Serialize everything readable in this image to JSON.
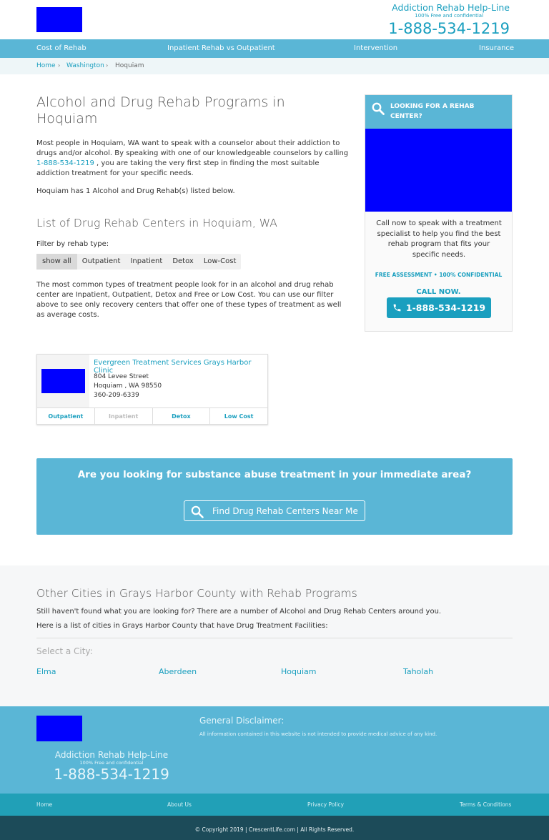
{
  "header": {
    "helpline_title": "Addiction Rehab Help-Line",
    "helpline_sub": "100% Free and confidential",
    "phone": "1-888-534-1219"
  },
  "nav": [
    "Cost of Rehab",
    "Inpatient Rehab vs Outpatient",
    "Intervention",
    "Insurance"
  ],
  "breadcrumb": [
    "Home",
    "Washington",
    "Hoquiam"
  ],
  "main": {
    "title": "Alcohol and Drug Rehab Programs in Hoquiam",
    "intro_pre": "Most people in Hoquiam, WA want to speak with a counselor about their addiction to drugs and/or alcohol. By speaking with one of our knowledgeable counselors by calling ",
    "intro_phone": "1-888-534-1219",
    "intro_post": " , you are taking the very first step in finding the most suitable addiction treatment for your specific needs.",
    "count_text": "Hoquiam has 1 Alcohol and Drug Rehab(s) listed below.",
    "list_title": "List of Drug Rehab Centers in Hoquiam, WA",
    "filter_label": "Filter by rehab type:",
    "filters": [
      "show all",
      "Outpatient",
      "Inpatient",
      "Detox",
      "Low-Cost"
    ],
    "filter_note": "The most common types of treatment people look for in an alcohol and drug rehab center are Inpatient, Outpatient, Detox and Free or Low Cost. You can use our filter above to see only recovery centers that offer one of these types of treatment as well as average costs."
  },
  "sidebar": {
    "heading_line1": "LOOKING FOR A REHAB",
    "heading_line2": "CENTER?",
    "call_text": "Call now to speak with a treatment specialist to help you find the best rehab program that fits your specific needs.",
    "free_text": "FREE ASSESSMENT • 100% CONFIDENTIAL",
    "call_now": "CALL NOW.",
    "phone": "1-888-534-1219"
  },
  "listing": {
    "name": "Evergreen Treatment Services Grays Harbor Clinic",
    "street": "804 Levee Street",
    "city": "Hoquiam , WA 98550",
    "phone": "360-209-6339",
    "tags": [
      {
        "label": "Outpatient",
        "active": true
      },
      {
        "label": "Inpatient",
        "active": false
      },
      {
        "label": "Detox",
        "active": true
      },
      {
        "label": "Low Cost",
        "active": true
      }
    ]
  },
  "cta": {
    "question": "Are you looking for substance abuse treatment in your immediate area?",
    "button": "Find Drug Rehab Centers Near Me"
  },
  "cities": {
    "title": "Other Cities in Grays Harbor County with Rehab Programs",
    "line1": "Still haven't found what you are looking for? There are a number of Alcohol and Drug Rehab Centers around you.",
    "line2": "Here is a list of cities in Grays Harbor County that have Drug Treatment Facilities:",
    "select_label": "Select a City:",
    "list": [
      "Elma",
      "Aberdeen",
      "Hoquiam",
      "Taholah"
    ]
  },
  "footer": {
    "helpline_title": "Addiction Rehab Help-Line",
    "helpline_sub": "100% Free and confidential",
    "phone": "1-888-534-1219",
    "disclaimer_title": "General Disclaimer:",
    "disclaimer_text": "All information contained in this website is not intended to provide medical advice of any kind.",
    "links": [
      "Home",
      "About Us",
      "Privacy Policy",
      "Terms & Conditions"
    ],
    "copyright": "© Copyright 2019 | CrescentLife.com | All Rights Reserved."
  },
  "colors": {
    "primary": "#5ab6d6",
    "link": "#1a9fbf",
    "dark_footer": "#1c4b59",
    "placeholder_image": "#0000ff"
  }
}
